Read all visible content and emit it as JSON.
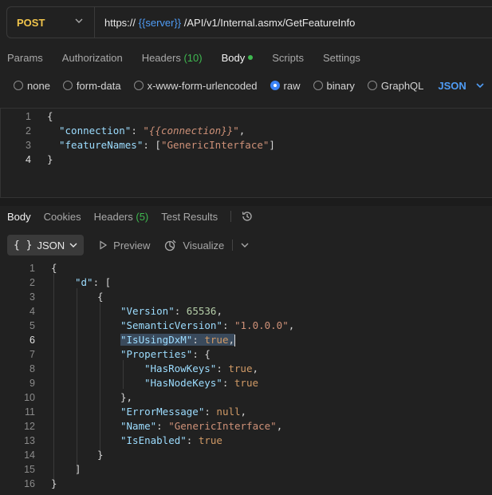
{
  "request": {
    "method": "POST",
    "url_prefix": "https://",
    "url_var": "{{server}}",
    "url_suffix": " /API/v1/Internal.asmx/GetFeatureInfo"
  },
  "request_tabs": [
    {
      "label": "Params"
    },
    {
      "label": "Authorization"
    },
    {
      "label": "Headers",
      "count": "(10)"
    },
    {
      "label": "Body",
      "active": true,
      "indicator": "green-dot"
    },
    {
      "label": "Scripts"
    },
    {
      "label": "Settings"
    }
  ],
  "body_types": [
    {
      "label": "none",
      "checked": false
    },
    {
      "label": "form-data",
      "checked": false
    },
    {
      "label": "x-www-form-urlencoded",
      "checked": false
    },
    {
      "label": "raw",
      "checked": true
    },
    {
      "label": "binary",
      "checked": false
    },
    {
      "label": "GraphQL",
      "checked": false
    }
  ],
  "raw_language": "JSON",
  "request_body": {
    "line_numbers": [
      "1",
      "2",
      "3",
      "4"
    ],
    "l1": "{",
    "l2_key": "\"connection\"",
    "l2_colon": ": ",
    "l2_value": "\"{{connection}}\"",
    "l2_comma": ",",
    "l3_key": "\"featureNames\"",
    "l3_colon": ": [",
    "l3_value": "\"GenericInterface\"",
    "l3_close": "]",
    "l4": "}"
  },
  "response_tabs": [
    {
      "label": "Body",
      "active": true
    },
    {
      "label": "Cookies"
    },
    {
      "label": "Headers",
      "count": "(5)"
    },
    {
      "label": "Test Results"
    }
  ],
  "response_toolbar": {
    "format_icon": "{ }",
    "format_label": "JSON",
    "preview_label": "Preview",
    "visualize_label": "Visualize"
  },
  "response_body": {
    "line_numbers": [
      "1",
      "2",
      "3",
      "4",
      "5",
      "6",
      "7",
      "8",
      "9",
      "10",
      "11",
      "12",
      "13",
      "14",
      "15",
      "16"
    ],
    "l1": "{",
    "l2_key": "\"d\"",
    "l2_rest": ": [",
    "l3": "{",
    "l4_key": "\"Version\"",
    "l4_colon": ": ",
    "l4_val": "65536",
    "l4_comma": ",",
    "l5_key": "\"SemanticVersion\"",
    "l5_colon": ": ",
    "l5_val": "\"1.0.0.0\"",
    "l5_comma": ",",
    "l6_key": "\"IsUsingDxM\"",
    "l6_colon": ": ",
    "l6_val": "true",
    "l6_comma": ",",
    "l7_key": "\"Properties\"",
    "l7_rest": ": {",
    "l8_key": "\"HasRowKeys\"",
    "l8_colon": ": ",
    "l8_val": "true",
    "l8_comma": ",",
    "l9_key": "\"HasNodeKeys\"",
    "l9_colon": ": ",
    "l9_val": "true",
    "l10": "},",
    "l11_key": "\"ErrorMessage\"",
    "l11_colon": ": ",
    "l11_val": "null",
    "l11_comma": ",",
    "l12_key": "\"Name\"",
    "l12_colon": ": ",
    "l12_val": "\"GenericInterface\"",
    "l12_comma": ",",
    "l13_key": "\"IsEnabled\"",
    "l13_colon": ": ",
    "l13_val": "true",
    "l14": "}",
    "l15": "]",
    "l16": "}"
  },
  "colors": {
    "method": "#f0c44b",
    "variable": "#4f9cf5",
    "accent_green": "#3fb950",
    "json_key": "#9cdcfe",
    "json_string": "#ce9178",
    "json_bool": "#d19a66"
  }
}
